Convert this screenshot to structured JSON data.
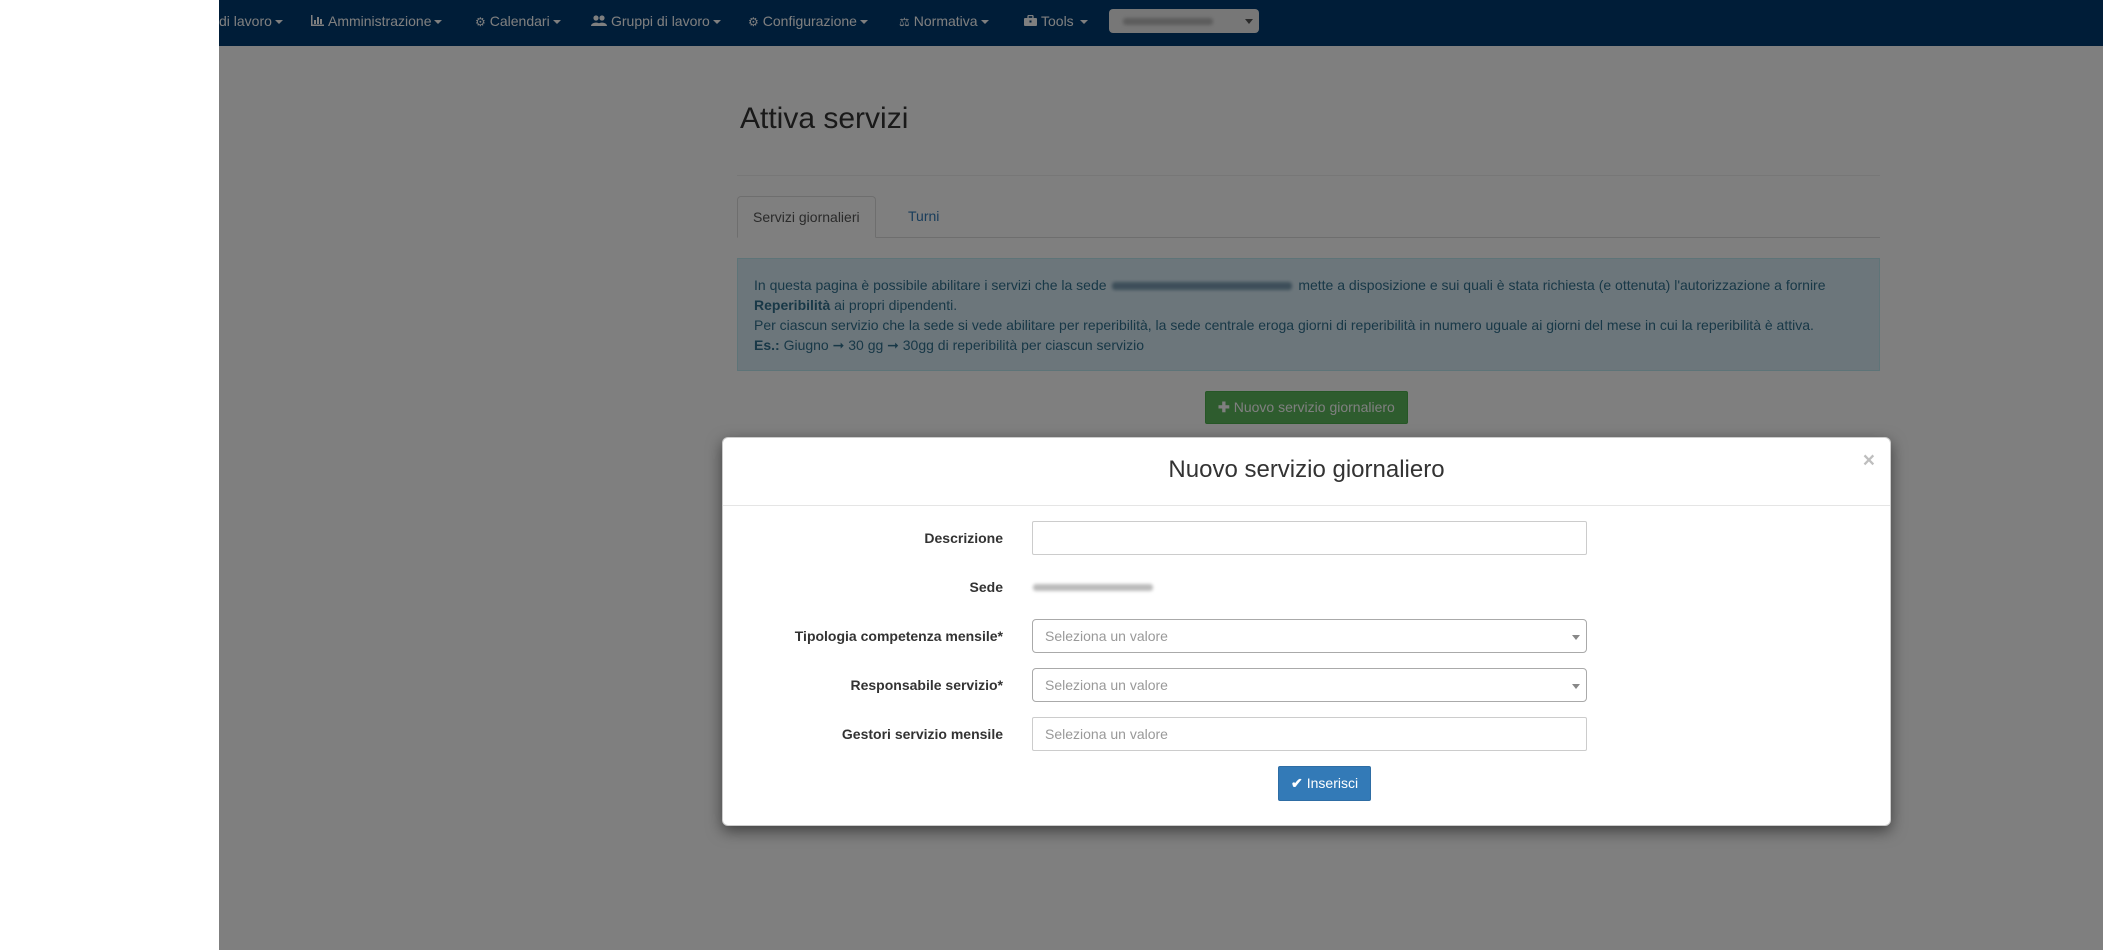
{
  "navbar": {
    "items": [
      {
        "label": "di lavoro",
        "icon": ""
      },
      {
        "label": "Amministrazione",
        "icon": "bar-chart-icon"
      },
      {
        "label": "Calendari",
        "icon": "gear-icon"
      },
      {
        "label": "Gruppi di lavoro",
        "icon": "users-icon"
      },
      {
        "label": "Configurazione",
        "icon": "gear-icon"
      },
      {
        "label": "Normativa",
        "icon": "balance-icon"
      },
      {
        "label": "Tools",
        "icon": "toolbox-icon"
      }
    ]
  },
  "page": {
    "title": "Attiva servizi",
    "tabs": [
      {
        "label": "Servizi giornalieri",
        "active": true
      },
      {
        "label": "Turni",
        "active": false
      }
    ],
    "info": {
      "line1_a": "In questa pagina è possibile abilitare i servizi che la sede",
      "line1_b": "mette a disposizione e sui quali è stata richiesta (e ottenuta) l'autorizzazione a fornire",
      "line2_bold": "Reperibilità",
      "line2_rest": " ai propri dipendenti.",
      "line3": "Per ciascun servizio che la sede si vede abilitare per reperibilità, la sede centrale eroga giorni di reperibilità in numero uguale ai giorni del mese in cui la reperibilità è attiva.",
      "line4_bold": "Es.:",
      "line4_rest": " Giugno ➞ 30 gg ➞ 30gg di reperibilità per ciascun servizio"
    },
    "new_button": "Nuovo servizio giornaliero"
  },
  "modal": {
    "title": "Nuovo servizio giornaliero",
    "close": "×",
    "fields": {
      "descrizione": {
        "label": "Descrizione",
        "value": ""
      },
      "sede": {
        "label": "Sede"
      },
      "tipologia": {
        "label": "Tipologia competenza mensile*",
        "placeholder": "Seleziona un valore"
      },
      "responsabile": {
        "label": "Responsabile servizio*",
        "placeholder": "Seleziona un valore"
      },
      "gestori": {
        "label": "Gestori servizio mensile",
        "placeholder": "Seleziona un valore"
      }
    },
    "submit": "Inserisci"
  },
  "colors": {
    "navbar": "#003a70",
    "success": "#5cb85c",
    "primary": "#337ab7",
    "info_bg": "#d9edf7",
    "info_text": "#31708f"
  }
}
